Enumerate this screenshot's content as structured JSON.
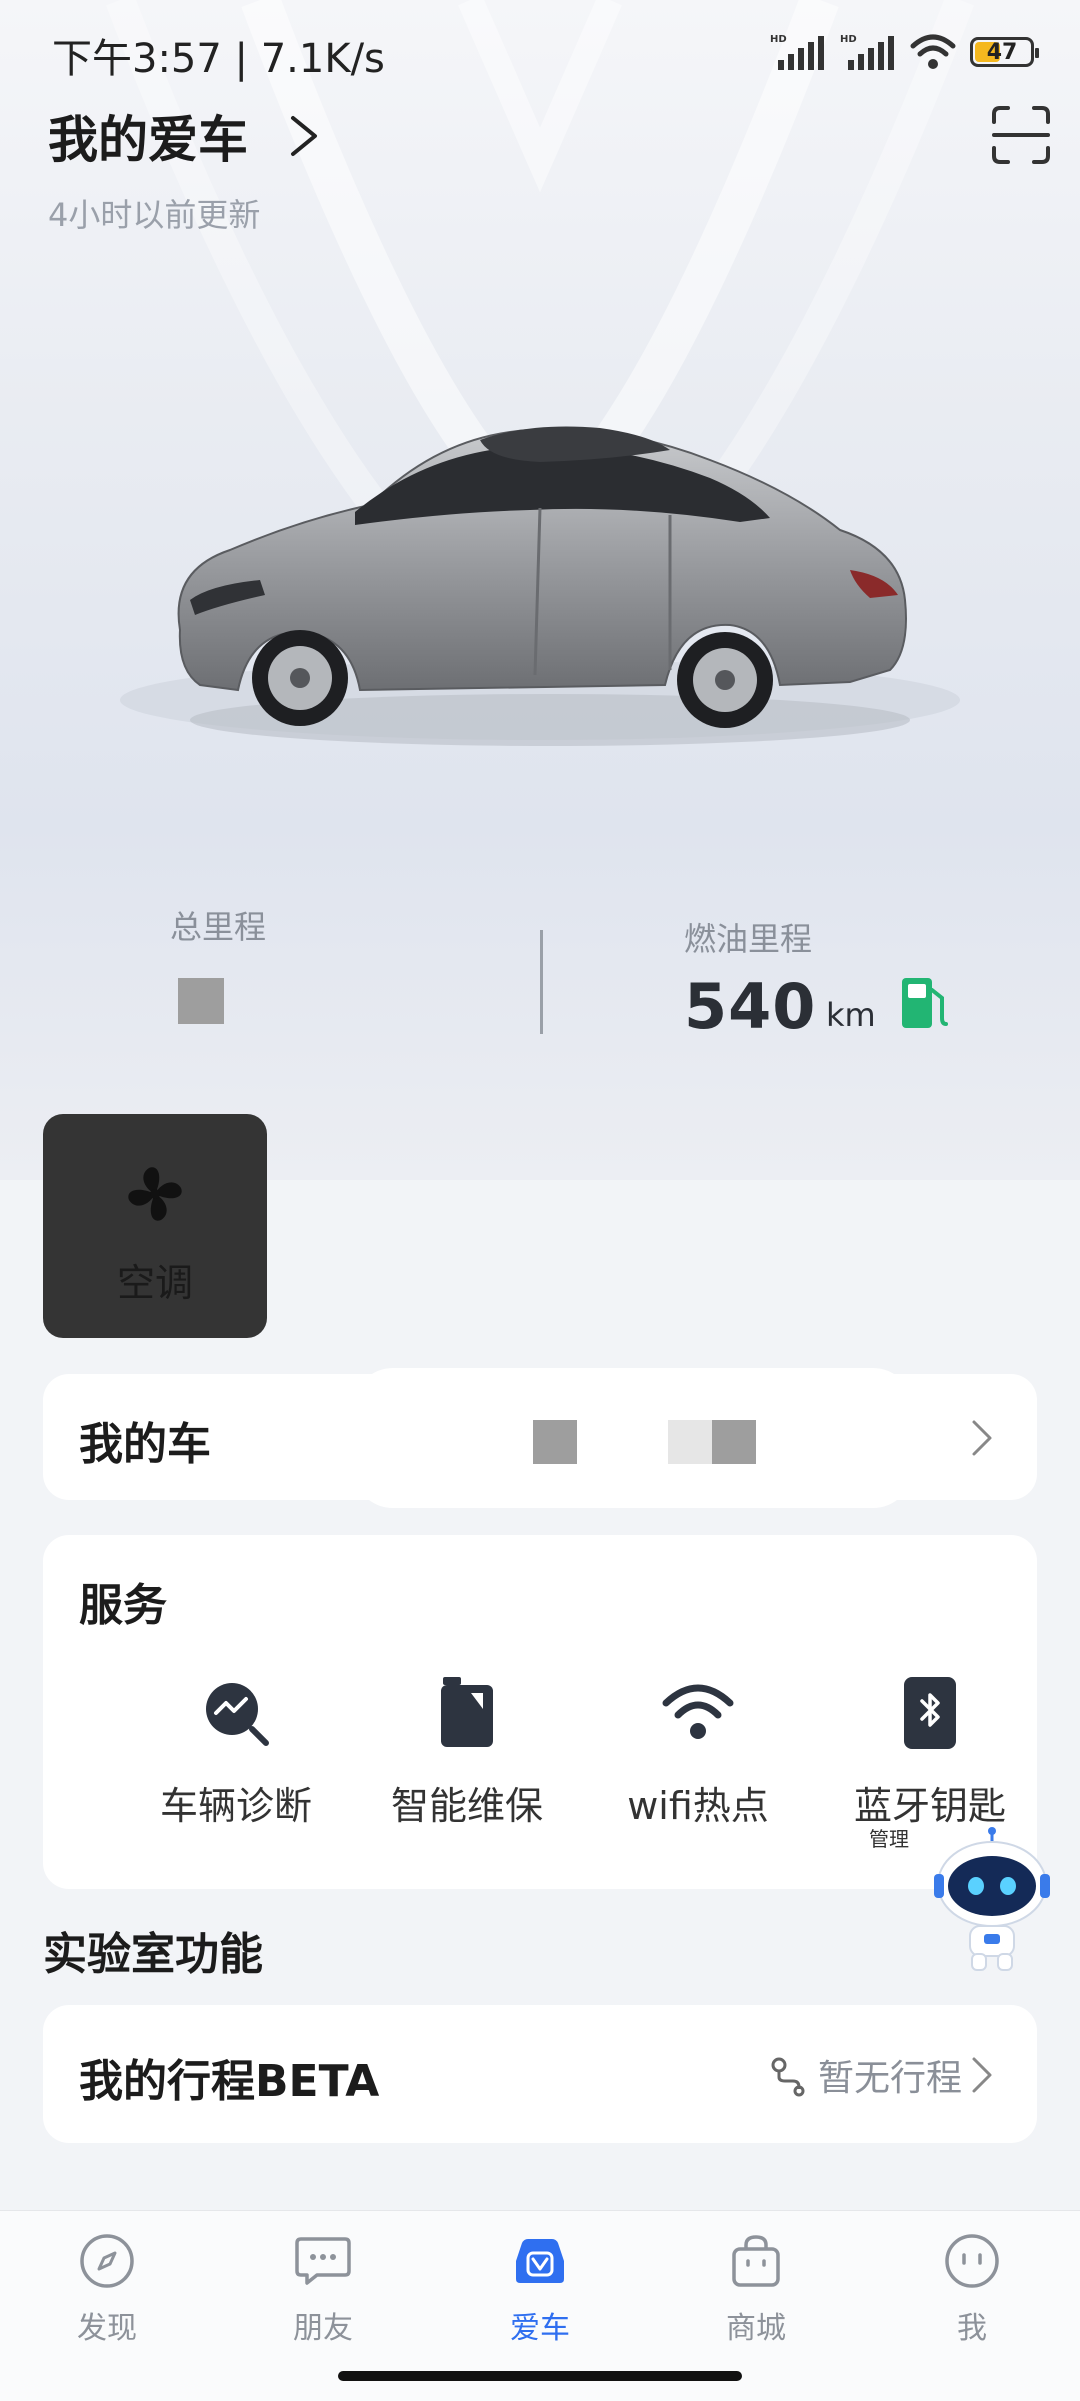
{
  "status_bar": {
    "time_speed": "下午3:57 | 7.1K/s",
    "battery": "47",
    "battery_level": 0.47,
    "signal_tag": "HD"
  },
  "header": {
    "title": "我的爱车",
    "updated": "4小时以前更新"
  },
  "mileage": {
    "total_label": "总里程",
    "fuel_label": "燃油里程",
    "fuel_value": "540",
    "fuel_unit": "km"
  },
  "quick_control": {
    "label": "空调",
    "icon": "fan-icon"
  },
  "my_car": {
    "label": "我的车"
  },
  "services": {
    "title": "服务",
    "items": [
      {
        "label": "车辆诊断",
        "icon": "diagnosis-icon"
      },
      {
        "label": "智能维保",
        "icon": "maintenance-icon"
      },
      {
        "label": "wifi热点",
        "icon": "wifi-icon"
      },
      {
        "label": "蓝牙钥匙",
        "icon": "bluetooth-key-icon"
      }
    ],
    "bluetooth_sub": "管理"
  },
  "lab": {
    "title": "实验室功能",
    "trip_label": "我的行程BETA",
    "trip_status": "暂无行程"
  },
  "nav": {
    "items": [
      {
        "label": "发现",
        "icon": "compass-icon"
      },
      {
        "label": "朋友",
        "icon": "chat-icon"
      },
      {
        "label": "爱车",
        "icon": "car-icon"
      },
      {
        "label": "商城",
        "icon": "shopping-bag-icon"
      },
      {
        "label": "我",
        "icon": "smiley-icon"
      }
    ],
    "active": "爱车"
  },
  "colors": {
    "accent": "#2f6ff0",
    "fuel": "#22b573",
    "tile": "#343434",
    "battery": "#f5b81f"
  }
}
